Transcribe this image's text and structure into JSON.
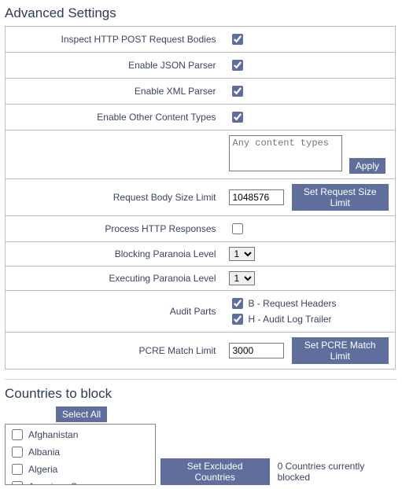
{
  "advanced": {
    "title": "Advanced Settings",
    "inspect_post_label": "Inspect HTTP POST Request Bodies",
    "inspect_post_checked": true,
    "json_parser_label": "Enable JSON Parser",
    "json_parser_checked": true,
    "xml_parser_label": "Enable XML Parser",
    "xml_parser_checked": true,
    "other_types_label": "Enable Other Content Types",
    "other_types_checked": true,
    "content_types_placeholder": "Any content types",
    "content_types_value": "",
    "apply_label": "Apply",
    "req_body_limit_label": "Request Body Size Limit",
    "req_body_limit_value": "1048576",
    "set_req_limit_label": "Set Request Size Limit",
    "process_responses_label": "Process HTTP Responses",
    "process_responses_checked": false,
    "blocking_paranoia_label": "Blocking Paranoia Level",
    "blocking_paranoia_value": "1",
    "executing_paranoia_label": "Executing Paranoia Level",
    "executing_paranoia_value": "1",
    "audit_parts_label": "Audit Parts",
    "audit_b_checked": true,
    "audit_b_label": "B - Request Headers",
    "audit_h_checked": true,
    "audit_h_label": "H - Audit Log Trailer",
    "pcre_limit_label": "PCRE Match Limit",
    "pcre_limit_value": "3000",
    "set_pcre_limit_label": "Set PCRE Match Limit"
  },
  "countries": {
    "title": "Countries to block",
    "select_all_label": "Select All",
    "items": [
      {
        "name": "Afghanistan",
        "checked": false
      },
      {
        "name": "Albania",
        "checked": false
      },
      {
        "name": "Algeria",
        "checked": false
      },
      {
        "name": "American Samoa",
        "checked": false
      }
    ],
    "set_excluded_label": "Set Excluded Countries",
    "status_text": "0 Countries currently blocked"
  }
}
